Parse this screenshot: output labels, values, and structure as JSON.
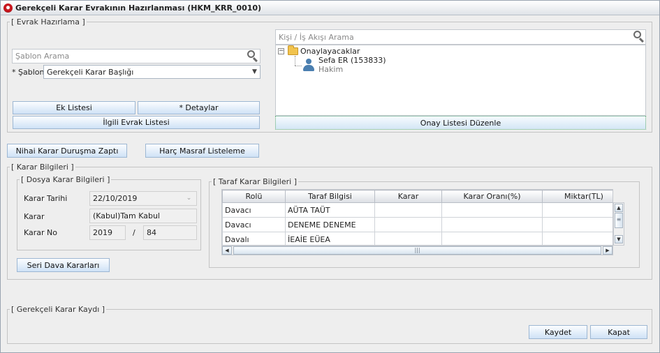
{
  "window": {
    "title": "Gerekçeli Karar Evrakının Hazırlanması (HKM_KRR_0010)"
  },
  "evrak_hazirlama": {
    "legend": "[ Evrak Hazırlama ]",
    "sablon_search_placeholder": "Şablon Arama",
    "sablon_label": "* Şablon",
    "sablon_value": "Gerekçeli Karar Başlığı",
    "ek_listesi": "Ek Listesi",
    "detaylar": "* Detaylar",
    "ilgili_evrak_listesi": "İlgili Evrak Listesi",
    "kisi_search_placeholder": "Kişi / İş Akışı Arama",
    "tree": {
      "root_label": "Onaylayacaklar",
      "person_name": "Sefa ER (153833)",
      "person_role": "Hakim"
    },
    "onay_listesi_duzenle": "Onay Listesi Düzenle"
  },
  "actions": {
    "nihai_karar": "Nihai Karar Duruşma Zaptı",
    "harc_masraf": "Harç Masraf Listeleme"
  },
  "karar_bilgileri": {
    "legend": "[ Karar Bilgileri ]",
    "dosya": {
      "legend": "[ Dosya Karar Bilgileri ]",
      "karar_tarihi_label": "Karar Tarihi",
      "karar_tarihi_value": "22/10/2019",
      "karar_label": "Karar",
      "karar_value": "(Kabul)Tam Kabul",
      "karar_no_label": "Karar No",
      "karar_no_year": "2019",
      "karar_no_sep": "/",
      "karar_no_num": "84"
    },
    "seri_dava_kararlari": "Seri Dava Kararları",
    "taraf": {
      "legend": "[ Taraf Karar Bilgileri ]",
      "columns": [
        "Rolü",
        "Taraf Bilgisi",
        "Karar",
        "Karar Oranı(%)",
        "Miktar(TL)"
      ],
      "rows": [
        [
          "Davacı",
          "AÜTA TAÜT",
          "",
          "",
          ""
        ],
        [
          "Davacı",
          "DENEME DENEME",
          "",
          "",
          ""
        ],
        [
          "Davalı",
          "İEAİE EÜEA",
          "",
          "",
          ""
        ]
      ]
    }
  },
  "gerekceli_karar_kaydi": {
    "legend": "[ Gerekçeli Karar Kaydı ]",
    "kaydet": "Kaydet",
    "kapat": "Kapat"
  },
  "icons": {
    "app": "app-emblem-icon",
    "search": "magnifier-icon",
    "folder": "folder-icon",
    "person": "user-icon",
    "dropdown": "chevron-down-icon"
  }
}
